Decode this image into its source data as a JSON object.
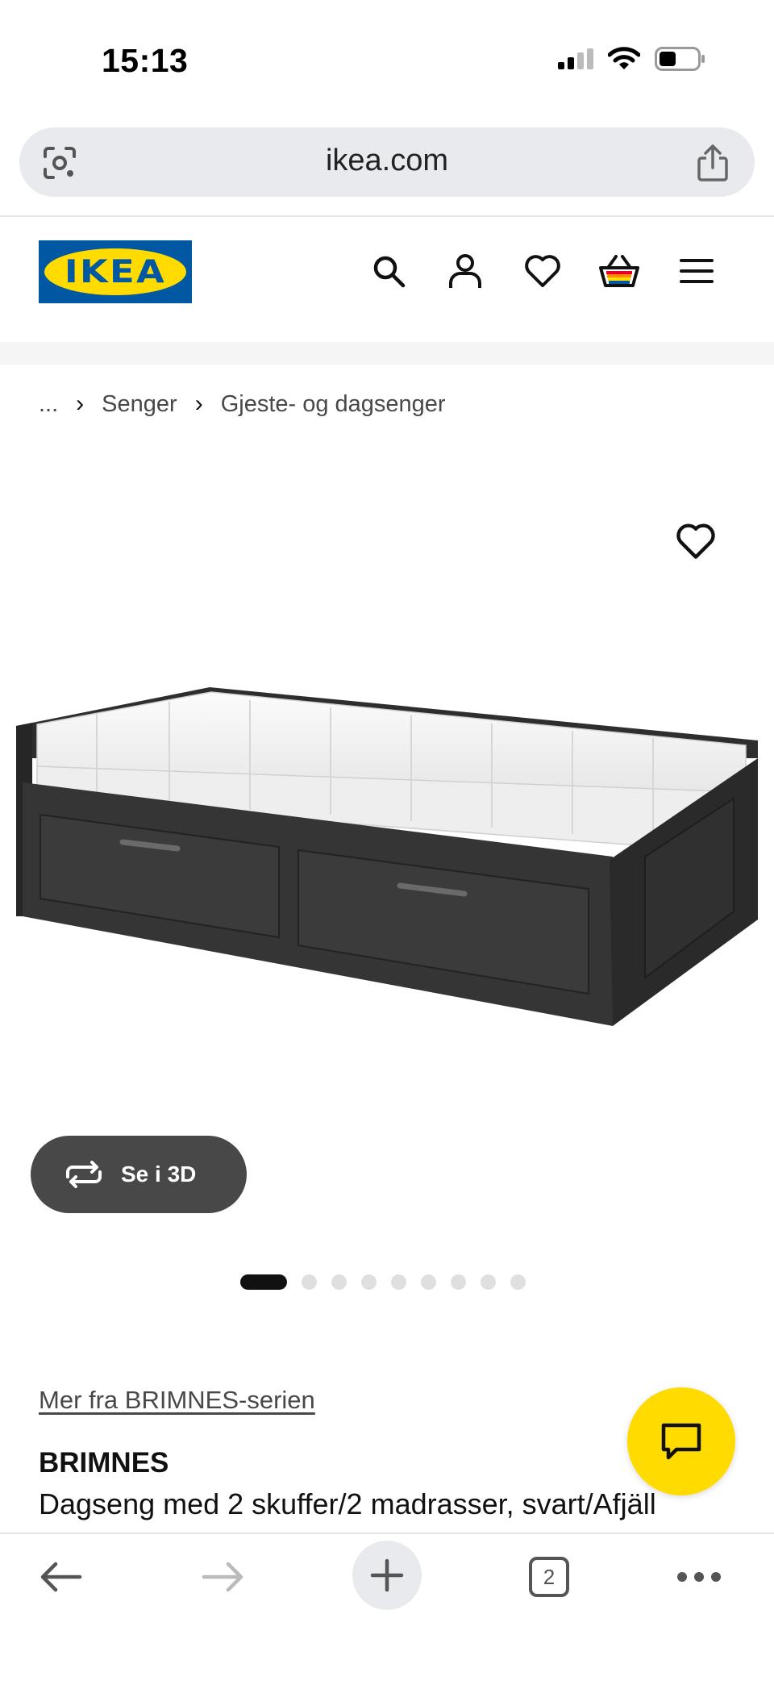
{
  "status": {
    "time": "15:13"
  },
  "browser": {
    "url": "ikea.com",
    "tab_count": "2"
  },
  "header": {
    "logo_text": "IKEA"
  },
  "breadcrumb": {
    "ellipsis": "...",
    "items": [
      "Senger",
      "Gjeste- og dagsenger"
    ]
  },
  "gallery": {
    "view_3d_label": "Se i 3D",
    "total_images": 9,
    "active_index": 0
  },
  "product": {
    "series_link": "Mer fra BRIMNES-serien",
    "name": "BRIMNES",
    "description": "Dagseng med 2 skuffer/2 madrasser, svart/Afjäll"
  },
  "colors": {
    "ikea_blue": "#0058a3",
    "ikea_yellow": "#ffdb00"
  }
}
